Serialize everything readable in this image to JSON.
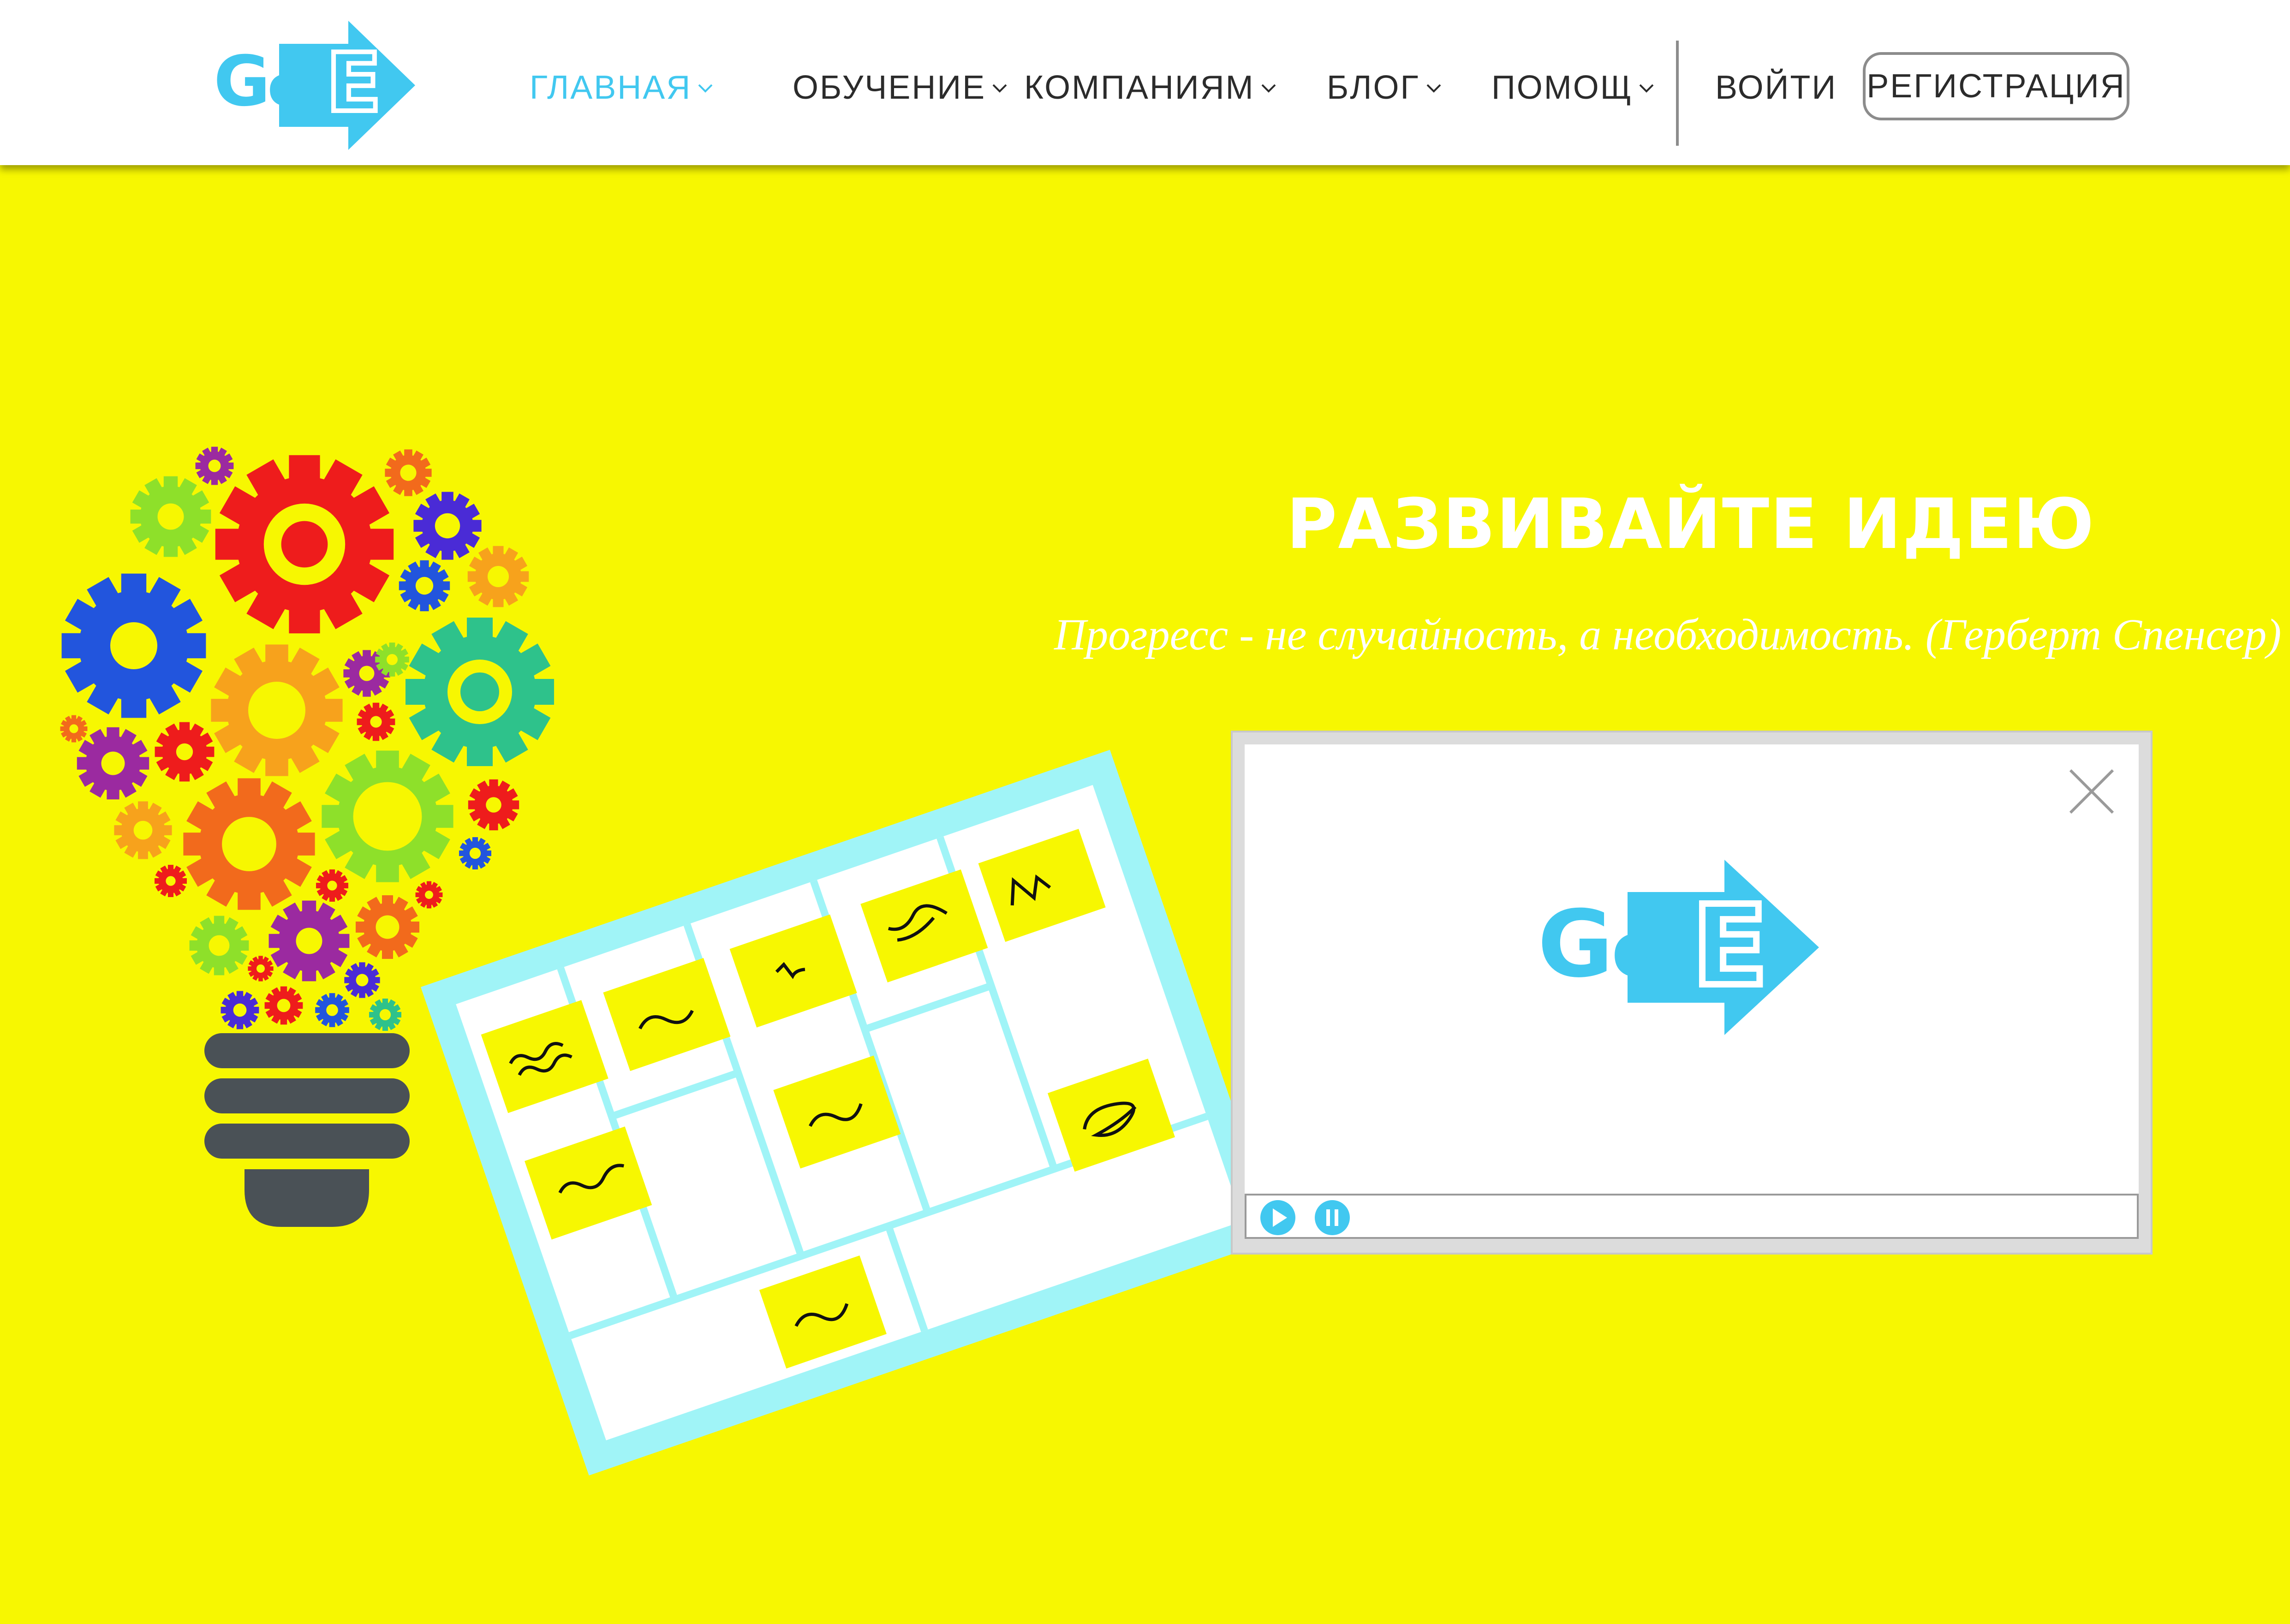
{
  "brand": {
    "logo_text": "GoE",
    "accent_color": "#41c8f0",
    "background_color": "#f7f701"
  },
  "nav": {
    "items": [
      {
        "label": "ГЛАВНАЯ",
        "active": true
      },
      {
        "label": "ОБУЧЕНИЕ",
        "active": false
      },
      {
        "label": "КОМПАНИЯМ",
        "active": false
      },
      {
        "label": "БЛОГ",
        "active": false
      },
      {
        "label": "ПОМОЩ",
        "active": false
      }
    ],
    "login_label": "ВОЙТИ",
    "register_label": "РЕГИСТРАЦИЯ"
  },
  "hero": {
    "title": "РАЗВИВАЙТЕ ИДЕЮ",
    "quote": "Прогресс - не случайность, а необходимость. (Герберт Спенсер)"
  },
  "player": {
    "logo_text": "GoE",
    "close_icon": "close-icon",
    "play_icon": "play-icon",
    "pause_icon": "pause-icon"
  },
  "illustration": {
    "lightbulb": "gear-lightbulb",
    "board": "sticky-note-board"
  }
}
